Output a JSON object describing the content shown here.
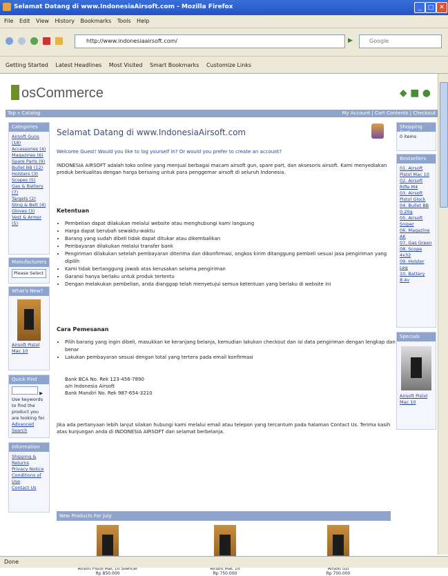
{
  "window": {
    "title": "Selamat Datang di www.IndonesiaAirsoft.com - Mozilla Firefox",
    "min_label": "_",
    "max_label": "□",
    "close_label": "✕"
  },
  "menu": [
    "File",
    "Edit",
    "View",
    "History",
    "Bookmarks",
    "Tools",
    "Help"
  ],
  "toolbar": {
    "url": "http://www.indonesiaairsoft.com/",
    "search_placeholder": "Google",
    "go_label": "▶"
  },
  "bookmarks": [
    "Getting Started",
    "Latest Headlines",
    "Most Visited",
    "Smart Bookmarks",
    "Customize Links"
  ],
  "site": {
    "logo": "osCommerce",
    "topnav_left": "Top » Catalog",
    "topnav_right": "My Account | Cart Contents | Checkout"
  },
  "left": {
    "categories_title": "Categories",
    "categories": [
      "Airsoft Guns (18)",
      "Accessories (4)",
      "Magazines (6)",
      "Spare Parts (9)",
      "Bullet BB (12)",
      "Holsters (3)",
      "Scopes (5)",
      "Gas & Battery (7)",
      "Targets (2)",
      "Sling & Belt (4)",
      "Gloves (3)",
      "Vest & Armor (5)"
    ],
    "manufacturers_title": "Manufacturers",
    "manufacturers_select": "Please Select",
    "whats_new_title": "What's New?",
    "whats_new_caption": "Airsoft Pistol Mac 10",
    "quick_find_title": "Quick Find",
    "quick_find_text": "Use keywords to find the product you are looking for.",
    "advanced_search": "Advanced Search",
    "information_title": "Information",
    "information": [
      "Shipping & Returns",
      "Privacy Notice",
      "Conditions of Use",
      "Contact Us"
    ]
  },
  "right": {
    "cart_title": "Shopping Cart",
    "cart_text": "0 items",
    "bestsellers_title": "Bestsellers",
    "bestsellers": [
      "01. Airsoft Pistol Mac 10",
      "02. Airsoft Rifle M4",
      "03. Airsoft Pistol Glock",
      "04. Bullet BB 0.20g",
      "05. Airsoft Sniper",
      "06. Magazine AK",
      "07. Gas Green",
      "08. Scope 4x32",
      "09. Holster Leg",
      "10. Battery 8.4v"
    ],
    "specials_title": "Specials",
    "specials_caption": "Airsoft Pistol Mac 10"
  },
  "main": {
    "heading": "Selamat Datang di www.IndonesiaAirsoft.com",
    "welcome": "Welcome Guest! Would you like to log yourself in? Or would you prefer to create an account?",
    "intro": "INDONESIA AIRSOFT adalah toko online yang menjual berbagai macam airsoft gun, spare part, dan aksesoris airsoft. Kami menyediakan produk berkualitas dengan harga bersaing untuk para penggemar airsoft di seluruh Indonesia.",
    "section1_title": "Ketentuan",
    "section1_items": [
      "Pembelian dapat dilakukan melalui website atau menghubungi kami langsung",
      "Harga dapat berubah sewaktu-waktu",
      "Barang yang sudah dibeli tidak dapat ditukar atau dikembalikan",
      "Pembayaran dilakukan melalui transfer bank",
      "Pengiriman dilakukan setelah pembayaran diterima dan dikonfirmasi, ongkos kirim ditanggung pembeli sesuai jasa pengiriman yang dipilih",
      "Kami tidak bertanggung jawab atas kerusakan selama pengiriman",
      "Garansi hanya berlaku untuk produk tertentu",
      "Dengan melakukan pembelian, anda dianggap telah menyetujui semua ketentuan yang berlaku di website ini"
    ],
    "section2_title": "Cara Pemesanan",
    "section2_items": [
      "Pilih barang yang ingin dibeli, masukkan ke keranjang belanja, kemudian lakukan checkout dan isi data pengiriman dengan lengkap dan benar",
      "Lakukan pembayaran sesuai dengan total yang tertera pada email konfirmasi"
    ],
    "bank_lines": [
      "Bank BCA No. Rek 123-456-7890",
      "a/n Indonesia Airsoft",
      "Bank Mandiri No. Rek 987-654-3210"
    ],
    "closing": "Jika ada pertanyaan lebih lanjut silakan hubungi kami melalui email atau telepon yang tercantum pada halaman Contact Us. Terima kasih atas kunjungan anda di INDONESIA AIRSOFT dan selamat berbelanja.",
    "new_products_title": "New Products For July",
    "products": [
      {
        "name": "Airsoft Pistol Mac 10 Silencer",
        "price": "Rp 850.000"
      },
      {
        "name": "Airsoft Mac 10",
        "price": "Rp 750.000"
      },
      {
        "name": "Airsoft Uzi",
        "price": "Rp 700.000"
      }
    ]
  },
  "status": "Done"
}
